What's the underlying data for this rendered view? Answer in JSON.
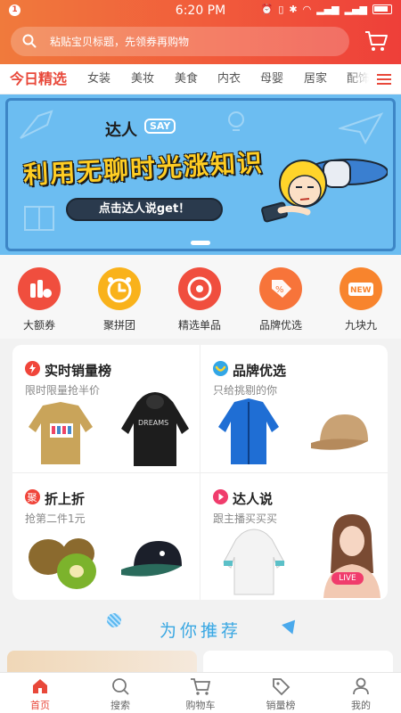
{
  "status_bar": {
    "notification_count": "1",
    "time": "6:20 PM"
  },
  "search": {
    "placeholder": "粘贴宝贝标题，先领券再购物"
  },
  "tabs": [
    {
      "label": "今日精选",
      "active": true
    },
    {
      "label": "女装"
    },
    {
      "label": "美妆"
    },
    {
      "label": "美食"
    },
    {
      "label": "内衣"
    },
    {
      "label": "母婴"
    },
    {
      "label": "居家"
    },
    {
      "label": "配饰"
    }
  ],
  "banner": {
    "brand": "达人",
    "badge": "SAY",
    "headline": "利用无聊时光涨知识",
    "cta": "点击达人说get！"
  },
  "icon_nav": [
    {
      "label": "大额券",
      "icon": "coupon-bars-icon",
      "color": "#f04e3e"
    },
    {
      "label": "聚拼团",
      "icon": "alarm-clock-icon",
      "color": "#f9b21b"
    },
    {
      "label": "精选单品",
      "icon": "target-icon",
      "color": "#f04e3e"
    },
    {
      "label": "品牌优选",
      "icon": "discount-tag-icon",
      "color": "#f7743a"
    },
    {
      "label": "九块九",
      "icon": "new-badge-icon",
      "color": "#f8842d"
    }
  ],
  "cards": [
    {
      "title": "实时销量榜",
      "subtitle": "限时限量抢半价",
      "icon": "lightning-icon",
      "icon_color": "#f0453a",
      "icon_glyph": "⚡"
    },
    {
      "title": "品牌优选",
      "subtitle": "只给挑剔的你",
      "icon": "smile-icon",
      "icon_color": "#32a6e6",
      "icon_glyph": "◡"
    },
    {
      "title": "折上折",
      "subtitle": "抢第二件1元",
      "icon": "ju-icon",
      "icon_color": "#f0453a",
      "icon_glyph": "聚"
    },
    {
      "title": "达人说",
      "subtitle": "跟主播买买买",
      "icon": "play-icon",
      "icon_color": "#f03c6c",
      "icon_glyph": "▶"
    }
  ],
  "products": {
    "hoodie_print": "DREAMS",
    "live_badge": "LIVE"
  },
  "recommend": {
    "title": "为你推荐"
  },
  "bottom_nav": [
    {
      "label": "首页",
      "icon": "home-icon",
      "active": true
    },
    {
      "label": "搜索",
      "icon": "search-icon"
    },
    {
      "label": "购物车",
      "icon": "cart-icon"
    },
    {
      "label": "销量榜",
      "icon": "price-tag-icon"
    },
    {
      "label": "我的",
      "icon": "user-icon"
    }
  ],
  "colors": {
    "accent": "#e8483a",
    "header_start": "#f07a3c",
    "header_end": "#ee3f39",
    "banner_bg": "#6cbdf1",
    "recommend_text": "#39a7e2"
  }
}
